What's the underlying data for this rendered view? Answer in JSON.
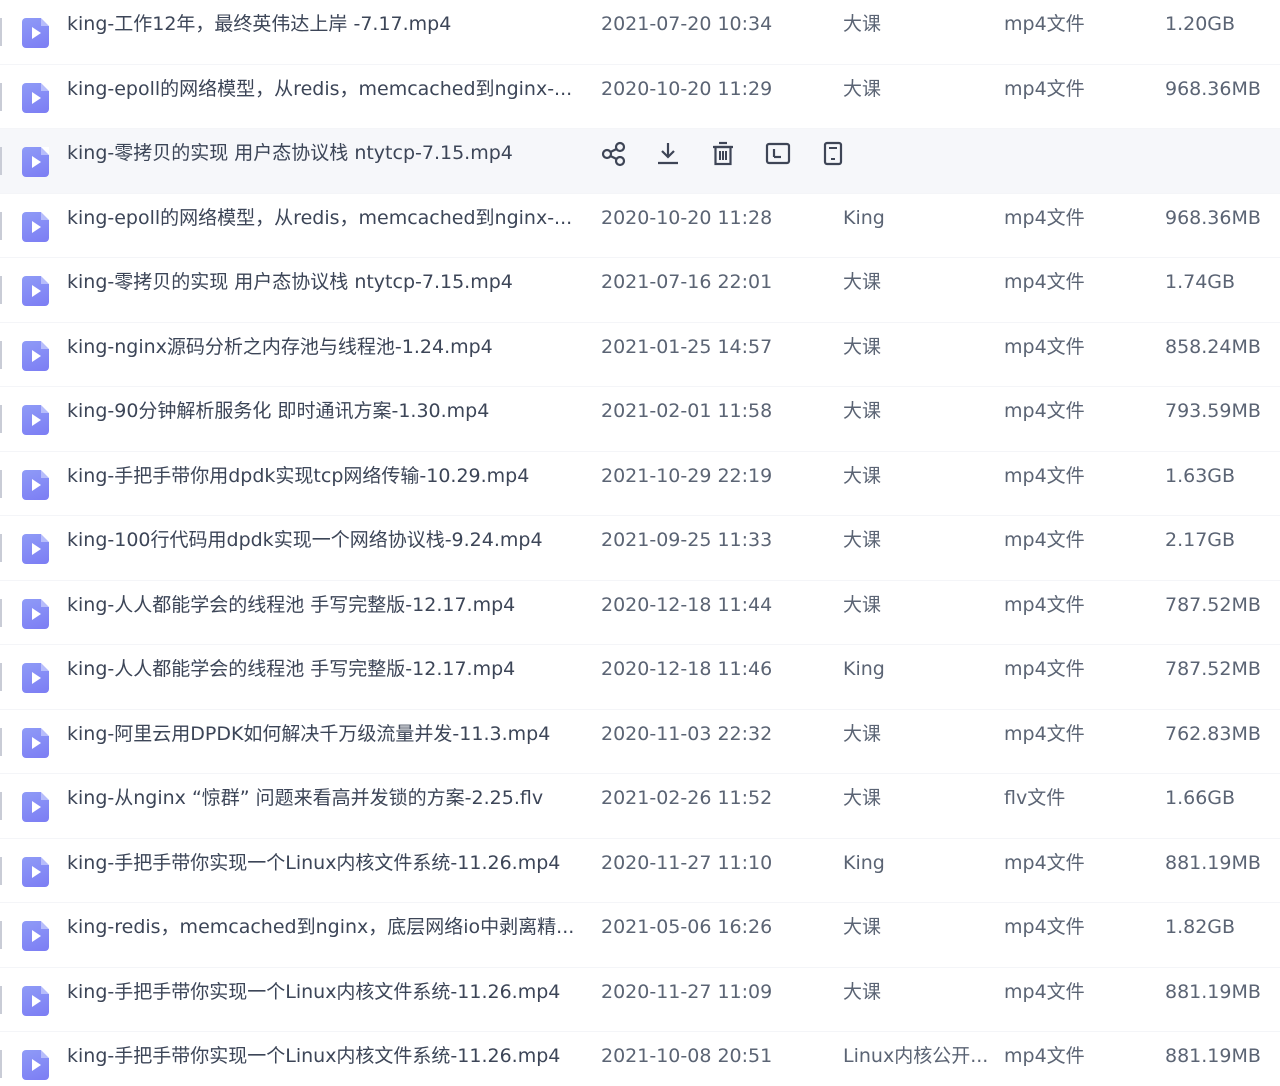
{
  "files": [
    {
      "name": "king-工作12年，最终英伟达上岸 -7.17.mp4",
      "date": "2021-07-20 10:34",
      "owner": "大课",
      "type": "mp4文件",
      "size": "1.20GB"
    },
    {
      "name": "king-epoll的网络模型，从redis，memcached到nginx-...",
      "date": "2020-10-20 11:29",
      "owner": "大课",
      "type": "mp4文件",
      "size": "968.36MB"
    },
    {
      "name": "king-零拷贝的实现 用户态协议栈 ntytcp-7.15.mp4",
      "date": "",
      "owner": "",
      "type": "",
      "size": "",
      "hovered": true
    },
    {
      "name": "king-epoll的网络模型，从redis，memcached到nginx-...",
      "date": "2020-10-20 11:28",
      "owner": "King",
      "type": "mp4文件",
      "size": "968.36MB"
    },
    {
      "name": "king-零拷贝的实现 用户态协议栈 ntytcp-7.15.mp4",
      "date": "2021-07-16 22:01",
      "owner": "大课",
      "type": "mp4文件",
      "size": "1.74GB"
    },
    {
      "name": "king-nginx源码分析之内存池与线程池-1.24.mp4",
      "date": "2021-01-25 14:57",
      "owner": "大课",
      "type": "mp4文件",
      "size": "858.24MB"
    },
    {
      "name": "king-90分钟解析服务化 即时通讯方案-1.30.mp4",
      "date": "2021-02-01 11:58",
      "owner": "大课",
      "type": "mp4文件",
      "size": "793.59MB"
    },
    {
      "name": "king-手把手带你用dpdk实现tcp网络传输-10.29.mp4",
      "date": "2021-10-29 22:19",
      "owner": "大课",
      "type": "mp4文件",
      "size": "1.63GB"
    },
    {
      "name": "king-100行代码用dpdk实现一个网络协议栈-9.24.mp4",
      "date": "2021-09-25 11:33",
      "owner": "大课",
      "type": "mp4文件",
      "size": "2.17GB"
    },
    {
      "name": "king-人人都能学会的线程池 手写完整版-12.17.mp4",
      "date": "2020-12-18 11:44",
      "owner": "大课",
      "type": "mp4文件",
      "size": "787.52MB"
    },
    {
      "name": "king-人人都能学会的线程池 手写完整版-12.17.mp4",
      "date": "2020-12-18 11:46",
      "owner": "King",
      "type": "mp4文件",
      "size": "787.52MB"
    },
    {
      "name": "king-阿里云用DPDK如何解决千万级流量并发-11.3.mp4",
      "date": "2020-11-03 22:32",
      "owner": "大课",
      "type": "mp4文件",
      "size": "762.83MB"
    },
    {
      "name": "king-从nginx “惊群” 问题来看高并发锁的方案-2.25.flv",
      "date": "2021-02-26 11:52",
      "owner": "大课",
      "type": "flv文件",
      "size": "1.66GB"
    },
    {
      "name": "king-手把手带你实现一个Linux内核文件系统-11.26.mp4",
      "date": "2020-11-27 11:10",
      "owner": "King",
      "type": "mp4文件",
      "size": "881.19MB"
    },
    {
      "name": "king-redis，memcached到nginx，底层网络io中剥离精...",
      "date": "2021-05-06 16:26",
      "owner": "大课",
      "type": "mp4文件",
      "size": "1.82GB"
    },
    {
      "name": "king-手把手带你实现一个Linux内核文件系统-11.26.mp4",
      "date": "2020-11-27 11:09",
      "owner": "大课",
      "type": "mp4文件",
      "size": "881.19MB"
    },
    {
      "name": "king-手把手带你实现一个Linux内核文件系统-11.26.mp4",
      "date": "2021-10-08 20:51",
      "owner": "Linux内核公开...",
      "type": "mp4文件",
      "size": "881.19MB"
    }
  ],
  "row_actions": {
    "share_icon": "share-icon",
    "download_icon": "download-icon",
    "delete_icon": "delete-icon",
    "rename_icon": "rename-icon",
    "more_icon": "more-icon"
  },
  "colors": {
    "file_icon": "#8a90f6",
    "hover_row": "#f6f7fa",
    "text": "#3c4557"
  }
}
